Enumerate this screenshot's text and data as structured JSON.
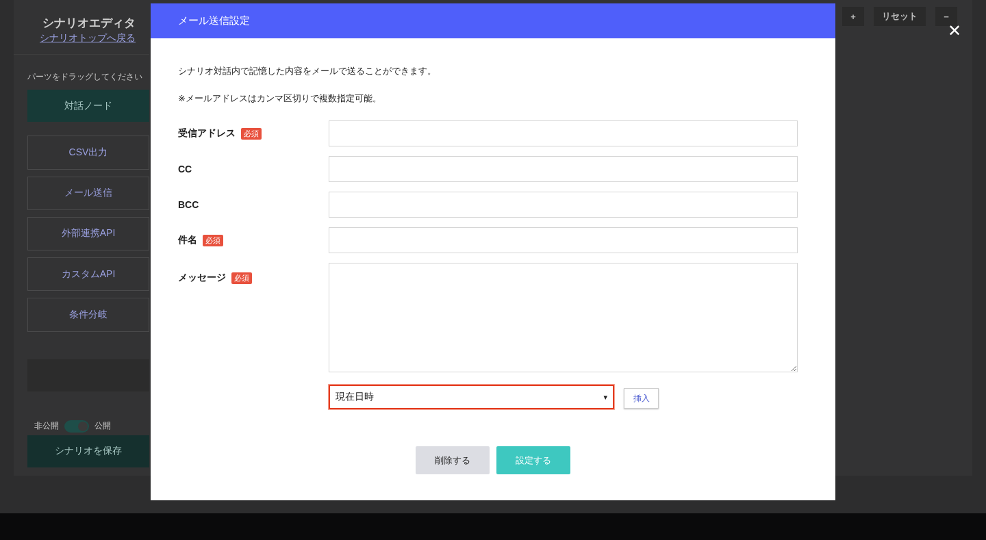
{
  "editor": {
    "title": "シナリオエディタ",
    "back_link": "シナリオトップへ戻る",
    "parts_hint": "パーツをドラッグしてください",
    "parts": [
      {
        "label": "対話ノード",
        "kind": "primary"
      },
      {
        "label": "CSV出力",
        "kind": "outline"
      },
      {
        "label": "メール送信",
        "kind": "outline"
      },
      {
        "label": "外部連携API",
        "kind": "outline"
      },
      {
        "label": "カスタムAPI",
        "kind": "outline"
      },
      {
        "label": "条件分岐",
        "kind": "outline"
      }
    ],
    "visibility": {
      "off_label": "非公開",
      "on_label": "公開",
      "on": true
    },
    "save_button": "シナリオを保存",
    "zoom_controls": [
      "+",
      "リセット",
      "−"
    ]
  },
  "dialog": {
    "title": "メール送信設定",
    "close": "✕",
    "notes": [
      "シナリオ対話内で記憶した内容をメールで送ることができます。",
      "※メールアドレスはカンマ区切りで複数指定可能。"
    ],
    "fields": [
      {
        "label": "受信アドレス",
        "required": true,
        "badge": "必須",
        "kind": "input"
      },
      {
        "label": "CC",
        "required": false,
        "kind": "input"
      },
      {
        "label": "BCC",
        "required": false,
        "kind": "input"
      },
      {
        "label": "件名",
        "required": true,
        "badge": "必須",
        "kind": "input"
      },
      {
        "label": "メッセージ",
        "required": true,
        "badge": "必須",
        "kind": "textarea"
      }
    ],
    "insert_select": {
      "value": "現在日時",
      "arrow": "▾"
    },
    "insert_button": "挿入",
    "buttons": [
      {
        "label": "削除する",
        "kind": "secondary"
      },
      {
        "label": "設定する",
        "kind": "primary"
      }
    ]
  }
}
